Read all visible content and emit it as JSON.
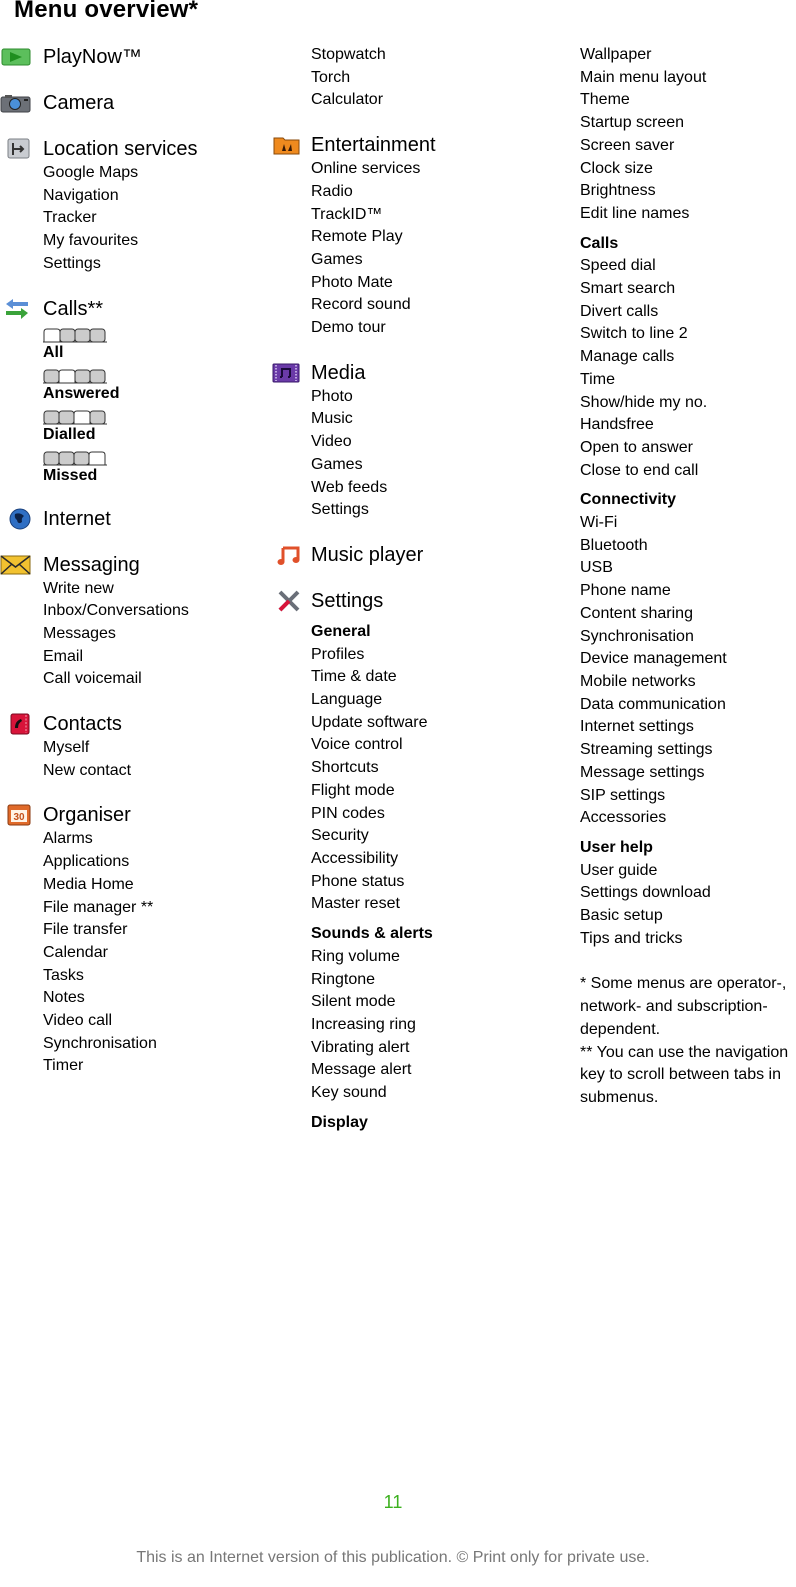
{
  "title": "Menu overview*",
  "col1": {
    "playnow": {
      "label": "PlayNow™"
    },
    "camera": {
      "label": "Camera"
    },
    "location": {
      "label": "Location services",
      "items": [
        "Google Maps",
        "Navigation",
        "Tracker",
        "My favourites",
        "Settings"
      ]
    },
    "calls": {
      "label": "Calls**",
      "tabs": [
        "All",
        "Answered",
        "Dialled",
        "Missed"
      ]
    },
    "internet": {
      "label": "Internet"
    },
    "messaging": {
      "label": "Messaging",
      "items": [
        "Write new",
        "Inbox/Conversations",
        "Messages",
        "Email",
        "Call voicemail"
      ]
    },
    "contacts": {
      "label": "Contacts",
      "items": [
        "Myself",
        "New contact"
      ]
    },
    "organiser": {
      "label": "Organiser",
      "items": [
        "Alarms",
        "Applications",
        "Media Home",
        "File manager **",
        "File transfer",
        "Calendar",
        "Tasks",
        "Notes",
        "Video call",
        "Synchronisation",
        "Timer"
      ]
    }
  },
  "col2": {
    "organiser_cont": [
      "Stopwatch",
      "Torch",
      "Calculator"
    ],
    "entertainment": {
      "label": "Entertainment",
      "items": [
        "Online services",
        "Radio",
        "TrackID™",
        "Remote Play",
        "Games",
        "Photo Mate",
        "Record sound",
        "Demo tour"
      ]
    },
    "media": {
      "label": "Media",
      "items": [
        "Photo",
        "Music",
        "Video",
        "Games",
        "Web feeds",
        "Settings"
      ]
    },
    "musicplayer": {
      "label": "Music player"
    },
    "settings": {
      "label": "Settings",
      "general": {
        "label": "General",
        "items": [
          "Profiles",
          "Time & date",
          "Language",
          "Update software",
          "Voice control",
          "Shortcuts",
          "Flight mode",
          "PIN codes",
          "Security",
          "Accessibility",
          "Phone status",
          "Master reset"
        ]
      },
      "sounds": {
        "label": "Sounds & alerts",
        "items": [
          "Ring volume",
          "Ringtone",
          "Silent mode",
          "Increasing ring",
          "Vibrating alert",
          "Message alert",
          "Key sound"
        ]
      },
      "display": {
        "label": "Display"
      }
    }
  },
  "col3": {
    "display_items": [
      "Wallpaper",
      "Main menu layout",
      "Theme",
      "Startup screen",
      "Screen saver",
      "Clock size",
      "Brightness",
      "Edit line names"
    ],
    "calls": {
      "label": "Calls",
      "items": [
        "Speed dial",
        "Smart search",
        "Divert calls",
        "Switch to line 2",
        "Manage calls",
        "Time",
        "Show/hide my no.",
        "Handsfree",
        "Open to answer",
        "Close to end call"
      ]
    },
    "connectivity": {
      "label": "Connectivity",
      "items": [
        "Wi-Fi",
        "Bluetooth",
        "USB",
        "Phone name",
        "Content sharing",
        "Synchronisation",
        "Device management",
        "Mobile networks",
        "Data communication",
        "Internet settings",
        "Streaming settings",
        "Message settings",
        "SIP settings",
        "Accessories"
      ]
    },
    "userhelp": {
      "label": "User help",
      "items": [
        "User guide",
        "Settings download",
        "Basic setup",
        "Tips and tricks"
      ]
    },
    "notes": [
      "* Some menus are operator-, network- and subscription-dependent.",
      "** You can use the navigation key to scroll between tabs in submenus."
    ]
  },
  "page_number": "11",
  "footer": "This is an Internet version of this publication. © Print only for private use.",
  "colors": {
    "page_number": "#3cb01e",
    "footer": "#777777"
  }
}
